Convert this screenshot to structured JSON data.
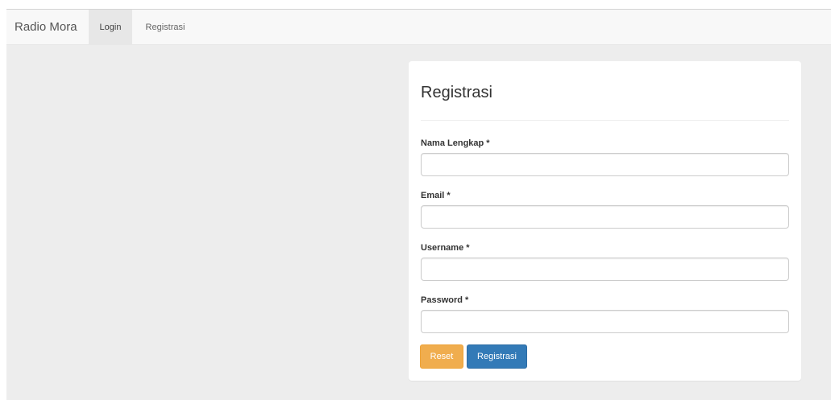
{
  "navbar": {
    "brand": "Radio Mora",
    "items": [
      {
        "label": "Login"
      },
      {
        "label": "Registrasi"
      }
    ]
  },
  "form": {
    "title": "Registrasi",
    "fields": [
      {
        "label": "Nama Lengkap *",
        "value": "",
        "placeholder": ""
      },
      {
        "label": "Email *",
        "value": "",
        "placeholder": ""
      },
      {
        "label": "Username *",
        "value": "",
        "placeholder": ""
      },
      {
        "label": "Password *",
        "value": "",
        "placeholder": ""
      }
    ],
    "buttons": {
      "reset": "Reset",
      "submit": "Registrasi"
    }
  },
  "colors": {
    "page_background": "#ededed",
    "navbar_background": "#f8f8f8",
    "reset_button": "#f0ad4e",
    "submit_button": "#337ab7"
  }
}
